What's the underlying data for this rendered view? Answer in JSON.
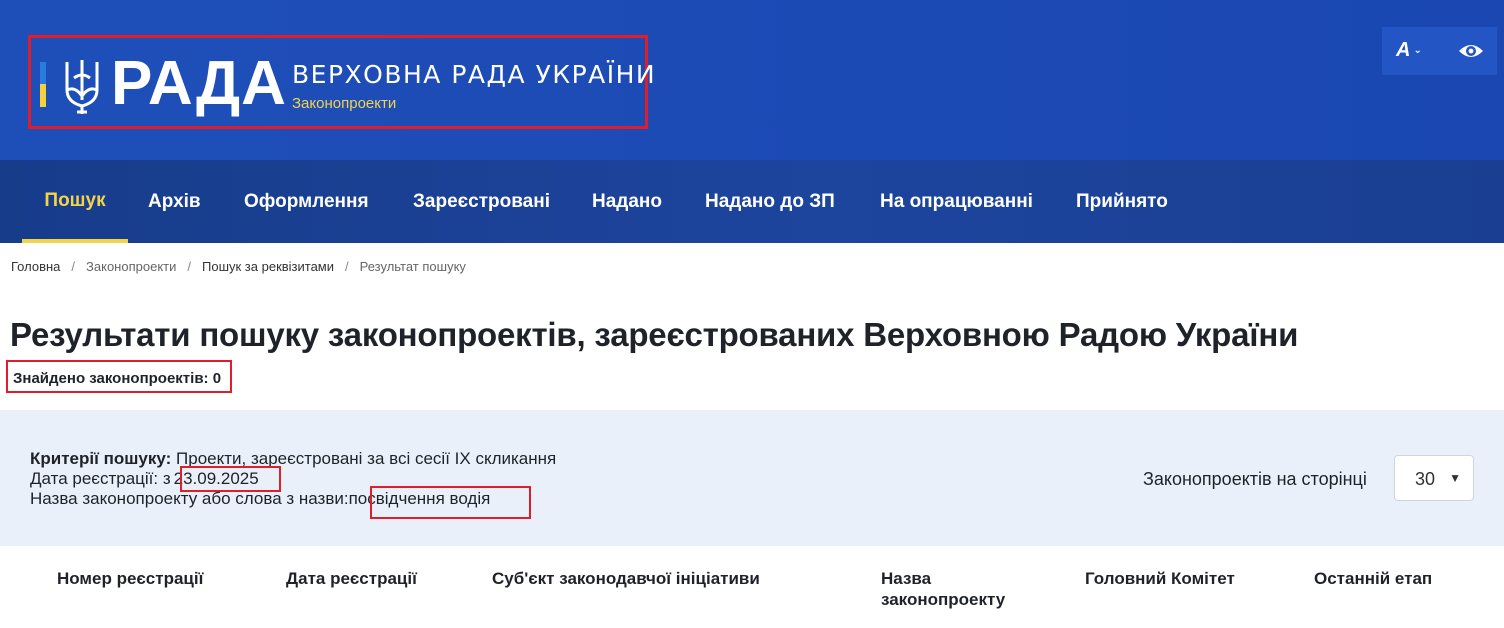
{
  "header": {
    "logo_word": "РАДА",
    "title": "ВЕРХОВНА РАДА УКРАЇНИ",
    "subtitle": "Законопроекти",
    "font_button": "A",
    "colors": {
      "bg": "#1d4bb6",
      "accent": "#f3d34a",
      "highlight": "#e01e2b"
    }
  },
  "nav": {
    "items": [
      {
        "label": "Пошук",
        "active": true
      },
      {
        "label": "Архів"
      },
      {
        "label": "Оформлення"
      },
      {
        "label": "Зареєстровані"
      },
      {
        "label": "Надано"
      },
      {
        "label": "Надано до ЗП"
      },
      {
        "label": "На опрацюванні"
      },
      {
        "label": "Прийнято"
      }
    ]
  },
  "breadcrumb": [
    "Головна",
    "Законопроекти",
    "Пошук за реквізитами",
    "Результат пошуку"
  ],
  "page": {
    "title": "Результати пошуку законопроектів, зареєстрованих Верховною Радою України",
    "found_label": "Знайдено законопроектів:",
    "found_count": "0"
  },
  "criteria": {
    "label": "Критерії пошуку:",
    "value": "Проекти, зареєстровані за всі сесії IX скликання",
    "date_label": "Дата реєстрації: з",
    "date_value": "23.09.2025",
    "name_label": "Назва законопроекту або слова з назви:",
    "name_value": "посвідчення водія"
  },
  "per_page": {
    "label": "Законопроектів на сторінці",
    "value": "30"
  },
  "table": {
    "headers": [
      "Номер реєстрації",
      "Дата реєстрації",
      "Суб'єкт законодавчої ініціативи",
      "Назва законопроекту",
      "Головний Комітет",
      "Останній етап"
    ]
  }
}
